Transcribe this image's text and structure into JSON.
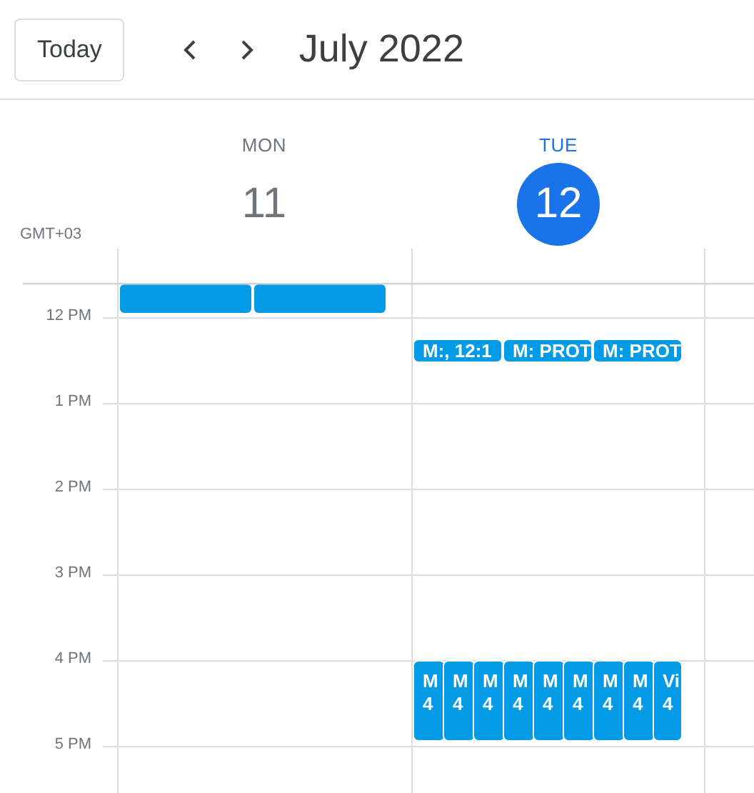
{
  "toolbar": {
    "today_button": "Today",
    "title": "July 2022"
  },
  "days": [
    {
      "weekday": "MON",
      "date": "11",
      "selected": false
    },
    {
      "weekday": "TUE",
      "date": "12",
      "selected": true
    }
  ],
  "timezone": "GMT+03",
  "hours": [
    "12 PM",
    "1 PM",
    "2 PM",
    "3 PM",
    "4 PM",
    "5 PM"
  ],
  "midday_events": [
    {
      "title": "M:, 12:1"
    },
    {
      "title": "M: PROT"
    },
    {
      "title": "M: PROT"
    }
  ],
  "afternoon_events": [
    {
      "title": "M",
      "time": "4"
    },
    {
      "title": "M",
      "time": "4"
    },
    {
      "title": "M",
      "time": "4"
    },
    {
      "title": "M",
      "time": "4"
    },
    {
      "title": "M",
      "time": "4"
    },
    {
      "title": "M",
      "time": "4"
    },
    {
      "title": "M",
      "time": "4"
    },
    {
      "title": "M",
      "time": "4"
    },
    {
      "title": "Vi",
      "time": "4"
    }
  ]
}
